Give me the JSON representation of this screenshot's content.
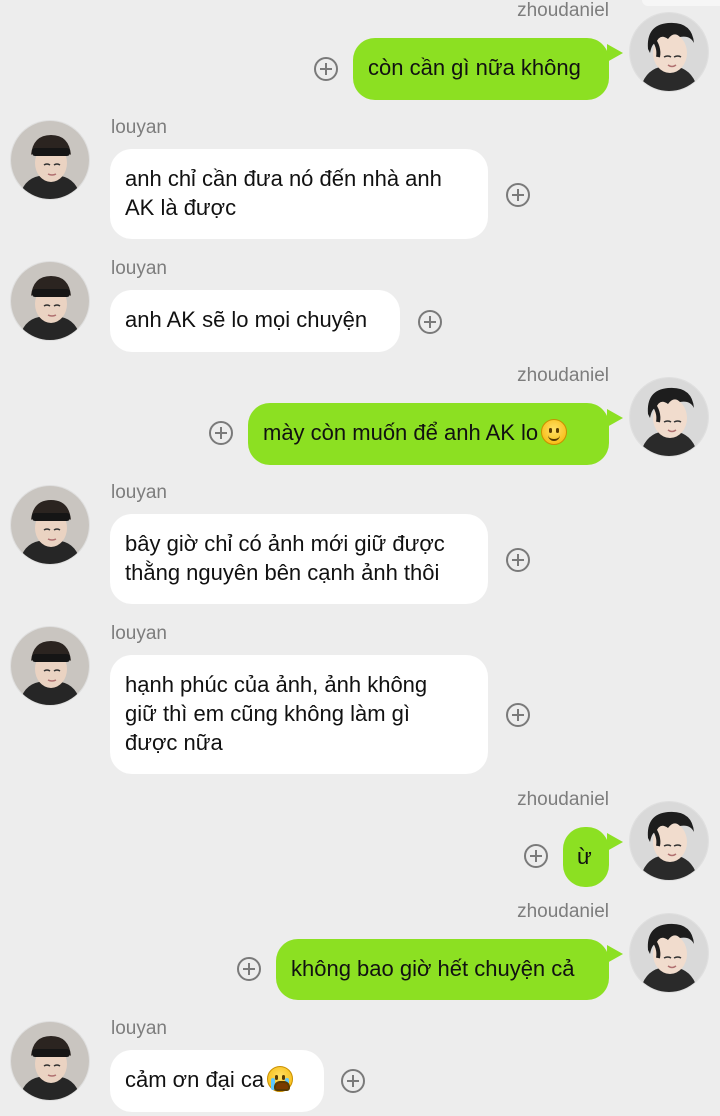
{
  "senders": {
    "right": "zhoudaniel",
    "left": "louyan"
  },
  "colors": {
    "background": "#ededed",
    "outgoing_bubble": "#8ce022",
    "incoming_bubble": "#ffffff",
    "username": "#7d7d7d"
  },
  "icons": {
    "add": "plus-circle-icon",
    "smile": "smiling-face-emoji",
    "cry": "loudly-crying-face-emoji"
  },
  "messages": [
    {
      "side": "right",
      "sender": "zhoudaniel",
      "text": "còn cần gì nữa không"
    },
    {
      "side": "left",
      "sender": "louyan",
      "text": "anh chỉ cần đưa nó đến nhà anh\nAK là được"
    },
    {
      "side": "left",
      "sender": "louyan",
      "text": "anh AK sẽ lo mọi chuyện"
    },
    {
      "side": "right",
      "sender": "zhoudaniel",
      "text": "mày còn muốn để anh AK lo",
      "emoji": "smile"
    },
    {
      "side": "left",
      "sender": "louyan",
      "text": "bây giờ chỉ có ảnh mới giữ được\nthằng nguyên bên cạnh ảnh thôi"
    },
    {
      "side": "left",
      "sender": "louyan",
      "text": "hạnh phúc của ảnh, ảnh không\ngiữ thì em cũng không làm gì\nđược nữa"
    },
    {
      "side": "right",
      "sender": "zhoudaniel",
      "text": "ừ"
    },
    {
      "side": "right",
      "sender": "zhoudaniel",
      "text": "không bao giờ hết chuyện cả"
    },
    {
      "side": "left",
      "sender": "louyan",
      "text": "cảm ơn đại ca",
      "emoji": "cry"
    }
  ]
}
